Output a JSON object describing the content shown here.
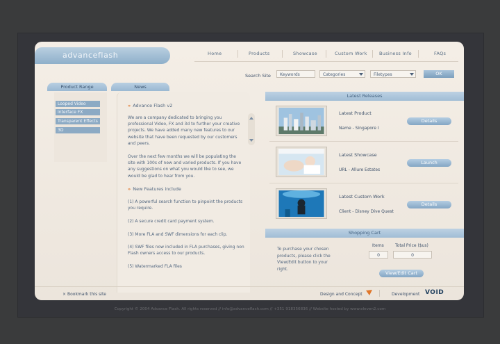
{
  "brand": {
    "logo": "advanceflash"
  },
  "nav": [
    "Home",
    "Products",
    "Showcase",
    "Custom Work",
    "Business Info",
    "FAQs"
  ],
  "search": {
    "label": "Search Site",
    "keywords": "Keywords",
    "categories": "Categories",
    "filetypes": "Filetypes",
    "ok": "OK"
  },
  "product_range": {
    "title": "Product Range",
    "items": [
      "Looped Video",
      "Interface FX",
      "Transparent Effects",
      "3D"
    ]
  },
  "news": {
    "title": "News",
    "heading1": "Advance Flash v2",
    "para1": "We are a company dedicated to bringing you professional Video, FX and 3d to further your creative projects. We have added many new features to our website that have been requested by our customers and peers.",
    "para2": "Over the next few months we will be populating the site with 100s of new and varied products. If you have any suggestions on what you would like to see, we would be glad to hear from you.",
    "heading2": "New Features include",
    "features": [
      "(1) A powerful search function to pinpoint the products you require.",
      "(2) A secure credit card payment system.",
      "(3) More FLA and SWF dimensions for each clip.",
      "(4) SWF files now included in FLA purchases, giving non Flash owners access to our products.",
      "(5) Watermarked FLA files"
    ]
  },
  "latest_releases": {
    "title": "Latest Releases",
    "rows": [
      {
        "title": "Latest Product",
        "sub": "Name - Singapore I",
        "button": "Details"
      },
      {
        "title": "Latest Showcase",
        "sub": "URL - Allure Estates",
        "button": "Launch"
      },
      {
        "title": "Latest Custom Work",
        "sub": "Client - Disney Dive Quest",
        "button": "Details"
      }
    ]
  },
  "cart": {
    "title": "Shopping Cart",
    "text": "To purchase your chosen products, please click the View/Edit button to your right.",
    "items_label": "Items",
    "items_value": "0",
    "total_label": "Total Price ($us)",
    "total_value": "0",
    "button": "View/Edit Cart"
  },
  "footer": {
    "bookmark": "Bookmark this site",
    "design": "Design and Concept",
    "development": "Development",
    "void_logo": "VOID",
    "copyright": "Copyright © 2004 Advance Flash. All rights reserved  //  info@advanceflash.com  //  +351 918356836  //  Website hosted by www.eleven2.com"
  },
  "colors": {
    "accent_blue": "#8eafca",
    "bg_cream": "#f1ebe3",
    "accent_orange": "#e0762a"
  }
}
